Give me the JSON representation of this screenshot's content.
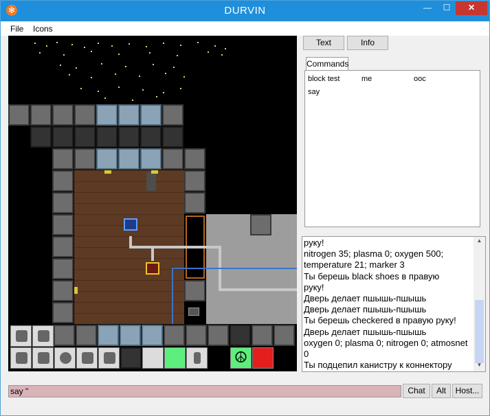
{
  "window": {
    "title": "DURVIN",
    "icon": "snowflake-icon"
  },
  "titlebar_buttons": {
    "minimize": "—",
    "maximize": "☐",
    "close": "✕"
  },
  "menu": {
    "file": "File",
    "icons": "Icons"
  },
  "right_panel": {
    "text_button": "Text",
    "info_button": "Info",
    "tab_label": "Commands",
    "commands": [
      [
        "block test",
        "me",
        "ooc"
      ],
      [
        "say",
        "",
        ""
      ]
    ]
  },
  "chat_lines": [
    "руку!",
    "nitrogen 35; plasma 0; oxygen 500;",
    "temperature 21; marker 3",
    "Ты берешь black shoes в правую",
    "руку!",
    "Дверь делает пшышь-пшышь",
    "Дверь делает пшышь-пшышь",
    "Ты берешь checkered в правую руку!",
    "Дверь делает пшышь-пшышь",
    "oxygen 0; plasma 0; nitrogen 0; atmosnet",
    "0",
    "Ты подцепил канистру к коннектору"
  ],
  "input": {
    "value": "say \""
  },
  "bottom_buttons": {
    "chat": "Chat",
    "alt": "Alt",
    "host": "Host..."
  },
  "hotbar": {
    "icons": [
      "rest-icon",
      "pull-icon",
      "hand-left-icon",
      "ear-icon",
      "mask-icon",
      "uniform-icon",
      "suit-icon",
      "storage-icon",
      "empty-slot",
      "intent-help-icon",
      "walk-icon",
      "peace-icon",
      "throw-icon"
    ]
  },
  "colors": {
    "titlebar": "#1f8fdc",
    "input_bg": "#d9b3b8",
    "intent_help": "#5dee7d",
    "throw": "#e41d1d"
  }
}
